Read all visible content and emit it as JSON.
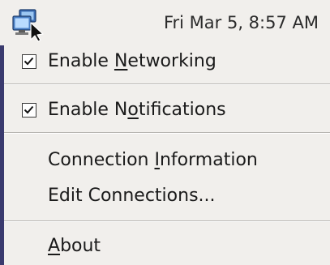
{
  "panel": {
    "tray_icon": "network-manager-icon",
    "clock": "Fri Mar  5,  8:57 AM"
  },
  "menu": {
    "items": [
      {
        "label_pre": "Enable ",
        "mnemonic": "N",
        "label_post": "etworking",
        "checked": true
      },
      {
        "label_pre": "Enable N",
        "mnemonic": "o",
        "label_post": "tifications",
        "checked": true
      },
      {
        "label_pre": "Connection ",
        "mnemonic": "I",
        "label_post": "nformation"
      },
      {
        "label_pre": "Edit Connections...",
        "mnemonic": "",
        "label_post": ""
      },
      {
        "label_pre": "",
        "mnemonic": "A",
        "label_post": "bout"
      }
    ]
  }
}
